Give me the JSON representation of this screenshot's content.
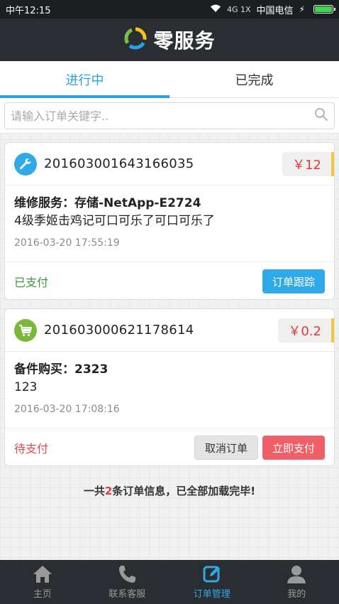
{
  "statusbar": {
    "time": "中午12:15",
    "network": "4G 1X",
    "carrier": "中国电信"
  },
  "header": {
    "title": "零服务"
  },
  "tabs": [
    {
      "label": "进行中",
      "active": true
    },
    {
      "label": "已完成",
      "active": false
    }
  ],
  "search": {
    "placeholder": "请输入订单关键字.."
  },
  "orders": [
    {
      "order_no": "201603001643166035",
      "price": "￥12",
      "title": "维修服务：存储-NetApp-E2724",
      "desc": "4级季姬击鸡记可口可乐了可口可乐了",
      "time": "2016-03-20 17:55:19",
      "status": "已支付",
      "buttons": [
        "订单跟踪"
      ],
      "icon": "wrench-icon",
      "icon_color": "#2fa9e8"
    },
    {
      "order_no": "201603000621178614",
      "price": "￥0.2",
      "title": "备件购买：2323",
      "desc": "123",
      "time": "2016-03-20 17:08:16",
      "status": "待支付",
      "buttons": [
        "取消订单",
        "立即支付"
      ],
      "icon": "cart-icon",
      "icon_color": "#7ab83a"
    }
  ],
  "summary": {
    "prefix": "一共",
    "count": "2",
    "suffix": "条订单信息，已全部加载完毕!"
  },
  "bottom_nav": [
    {
      "label": "主页",
      "icon": "home-icon",
      "active": false
    },
    {
      "label": "联系客服",
      "icon": "phone-icon",
      "active": false
    },
    {
      "label": "订单管理",
      "icon": "edit-icon",
      "active": true
    },
    {
      "label": "我的",
      "icon": "user-icon",
      "active": false
    }
  ],
  "colors": {
    "accent": "#2aa0e8",
    "price": "#e23a3a",
    "paid": "#3a9a3a",
    "unpaid": "#e0484f",
    "header_bg": "#2a2d31"
  }
}
